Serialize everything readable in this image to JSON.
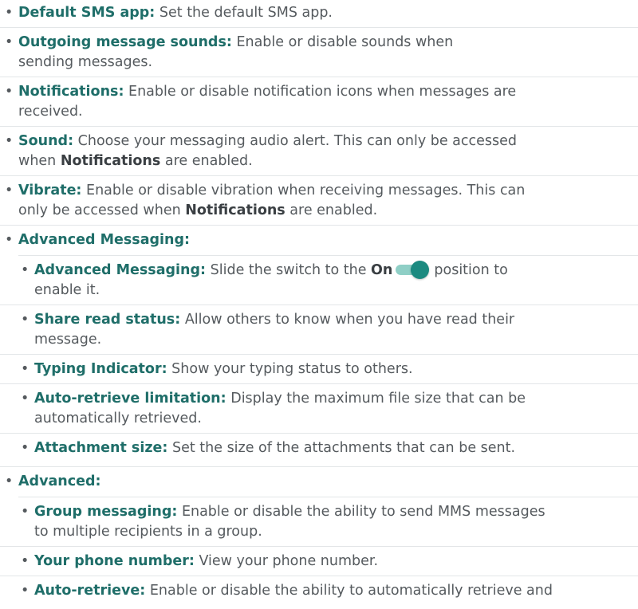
{
  "items": [
    {
      "term": "Default SMS app:",
      "desc": "Set the default SMS app."
    },
    {
      "term": "Outgoing message sounds:",
      "desc_l1": "Enable or disable sounds when",
      "desc_l2": "sending messages."
    },
    {
      "term": "Notifications:",
      "desc_l1": "Enable or disable notification icons when messages are",
      "desc_l2": "received."
    },
    {
      "term": "Sound:",
      "desc_a": "Choose your messaging audio alert. This can only be accessed",
      "desc_b": "when",
      "bold": "Notifications",
      "desc_c": "are enabled."
    },
    {
      "term": "Vibrate:",
      "desc_a": "Enable or disable vibration when receiving messages. This can",
      "desc_b": "only be accessed when",
      "bold": "Notifications",
      "desc_c": "are enabled."
    }
  ],
  "advanced_messaging": {
    "heading": "Advanced Messaging:",
    "items": [
      {
        "term": "Advanced Messaging:",
        "desc_a": "Slide the switch to the",
        "bold": "On",
        "desc_b": "position to",
        "desc_c": "enable it.",
        "toggle_state": "on",
        "toggle_color": "#1c8a80"
      },
      {
        "term": "Share read status:",
        "desc_l1": "Allow others to know when you have read their",
        "desc_l2": "message."
      },
      {
        "term": "Typing Indicator:",
        "desc": "Show your typing status to others."
      },
      {
        "term": "Auto-retrieve limitation:",
        "desc_l1": "Display the maximum file size that can be",
        "desc_l2": "automatically retrieved."
      },
      {
        "term": "Attachment size:",
        "desc": "Set the size of the attachments that can be sent."
      }
    ]
  },
  "advanced": {
    "heading": "Advanced:",
    "items": [
      {
        "term": "Group messaging:",
        "desc_l1": "Enable or disable the ability to send MMS messages",
        "desc_l2": "to multiple recipients in a group."
      },
      {
        "term": "Your phone number:",
        "desc": "View your phone number."
      },
      {
        "term": "Auto-retrieve:",
        "desc": "Enable or disable the ability to automatically retrieve and"
      }
    ]
  },
  "colors": {
    "term": "#1f6e69",
    "body_text": "#555a5e",
    "toggle_on": "#1c8a80"
  }
}
